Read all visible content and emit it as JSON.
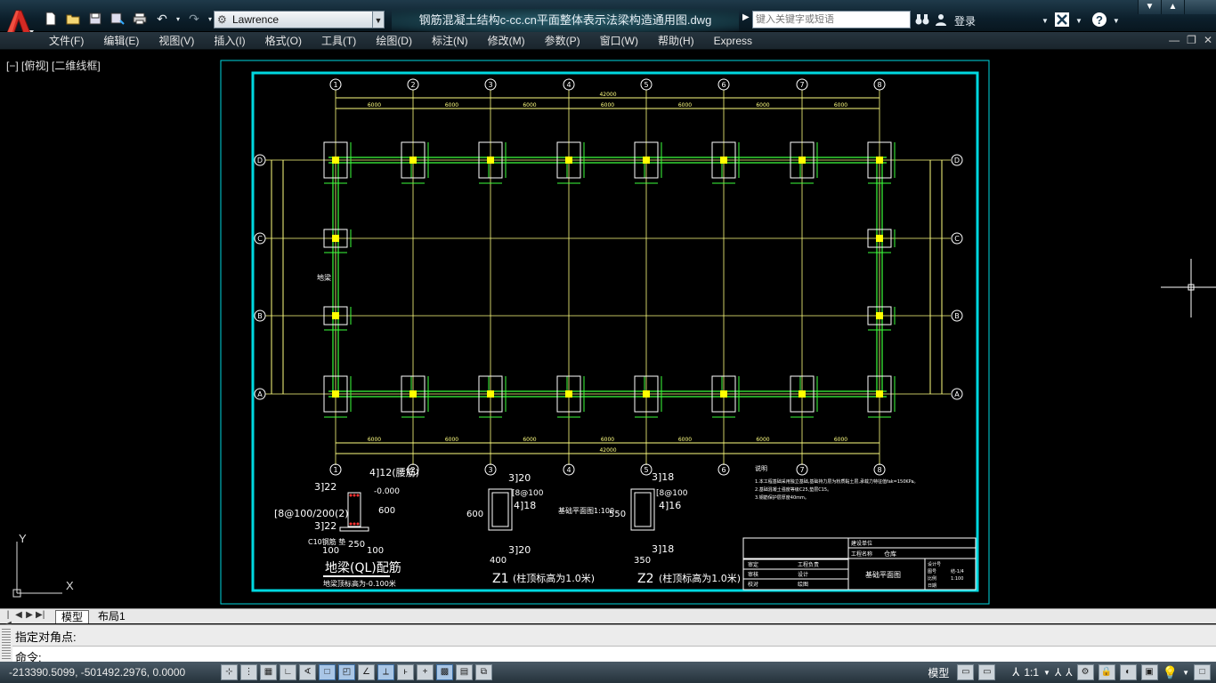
{
  "title_bar": {
    "workspace": "Lawrence",
    "document_title": "钢筋混凝土结构c-cc.cn平面整体表示法梁构造通用图.dwg",
    "search_placeholder": "键入关键字或短语",
    "login_label": "登录"
  },
  "menu": {
    "items": [
      "文件(F)",
      "编辑(E)",
      "视图(V)",
      "插入(I)",
      "格式(O)",
      "工具(T)",
      "绘图(D)",
      "标注(N)",
      "修改(M)",
      "参数(P)",
      "窗口(W)",
      "帮助(H)",
      "Express"
    ]
  },
  "viewport": {
    "label": "[−] [俯视] [二维线框]",
    "ucs_x": "X",
    "ucs_y": "Y"
  },
  "drawing": {
    "grid_columns": [
      "1",
      "2",
      "3",
      "4",
      "5",
      "6",
      "7",
      "8"
    ],
    "grid_rows": [
      "D",
      "C",
      "B",
      "A"
    ],
    "total_dimension": "42000",
    "bay_dimension": "6000",
    "details": {
      "beam_title": "地梁(QL)配筋",
      "beam_note": "地梁顶标高为-0.100米",
      "beam_top_bar": "4]12(腰筋)",
      "beam_bar1": "3]22",
      "beam_bar2": "3]22",
      "beam_stirrup": "[8@100/200(2)",
      "beam_level": "-0.000",
      "beam_height": "600",
      "beam_width": "250",
      "beam_hook": "C10钢筋 垫",
      "beam_dim_left": "100",
      "beam_dim_right": "100",
      "z1_title": "Z1",
      "z1_note": "(柱顶标高为1.0米)",
      "z1_top": "3]20",
      "z1_bottom": "3]20",
      "z1_stirrup": "[8@100",
      "z1_side": "4]18",
      "z1_height": "600",
      "z1_width": "400",
      "z2_title": "Z2",
      "z2_note": "(柱顶标高为1.0米)",
      "z2_top": "3]18",
      "z2_bottom": "3]18",
      "z2_stirrup": "[8@100",
      "z2_side": "4]16",
      "z2_height": "550",
      "z2_width": "350",
      "base_label": "基础平面图1:100",
      "ground_beam_label": "地梁",
      "notes_title": "说明",
      "notes": [
        "1.本工程基础采用独立基础,基础持力层为粉质黏土层,承载力特征值fak=150KPa。",
        "2.基础混凝土强度等级C25,垫层C15。",
        "3.钢筋保护层厚度40mm。"
      ],
      "titleblock_unit": "建设单位",
      "titleblock_project": "工程名称",
      "titleblock_project_value": "仓库",
      "titleblock_drawing": "基础平面图",
      "titleblock_rows": [
        [
          "审定",
          "工程负责"
        ],
        [
          "审核",
          "设计"
        ],
        [
          "校对",
          "绘图"
        ]
      ],
      "titleblock_right": [
        [
          "设计号",
          ""
        ],
        [
          "图号",
          "结-1/4"
        ],
        [
          "比例",
          "1:100"
        ],
        [
          "日期",
          ""
        ]
      ]
    }
  },
  "tabs": {
    "model": "模型",
    "layout1": "布局1"
  },
  "command": {
    "history": "指定对角点:",
    "prompt": "命令:"
  },
  "status_bar": {
    "coordinates": "-213390.5099, -501492.2976, 0.0000",
    "model_label": "模型",
    "annotation_scale": "1:1"
  },
  "colors": {
    "cyan_border": "#00d8e0",
    "grid_line": "#ffff80",
    "beam_green": "#3cff3c",
    "column_yellow": "#ffff00",
    "menubar": "#1f2c35"
  }
}
